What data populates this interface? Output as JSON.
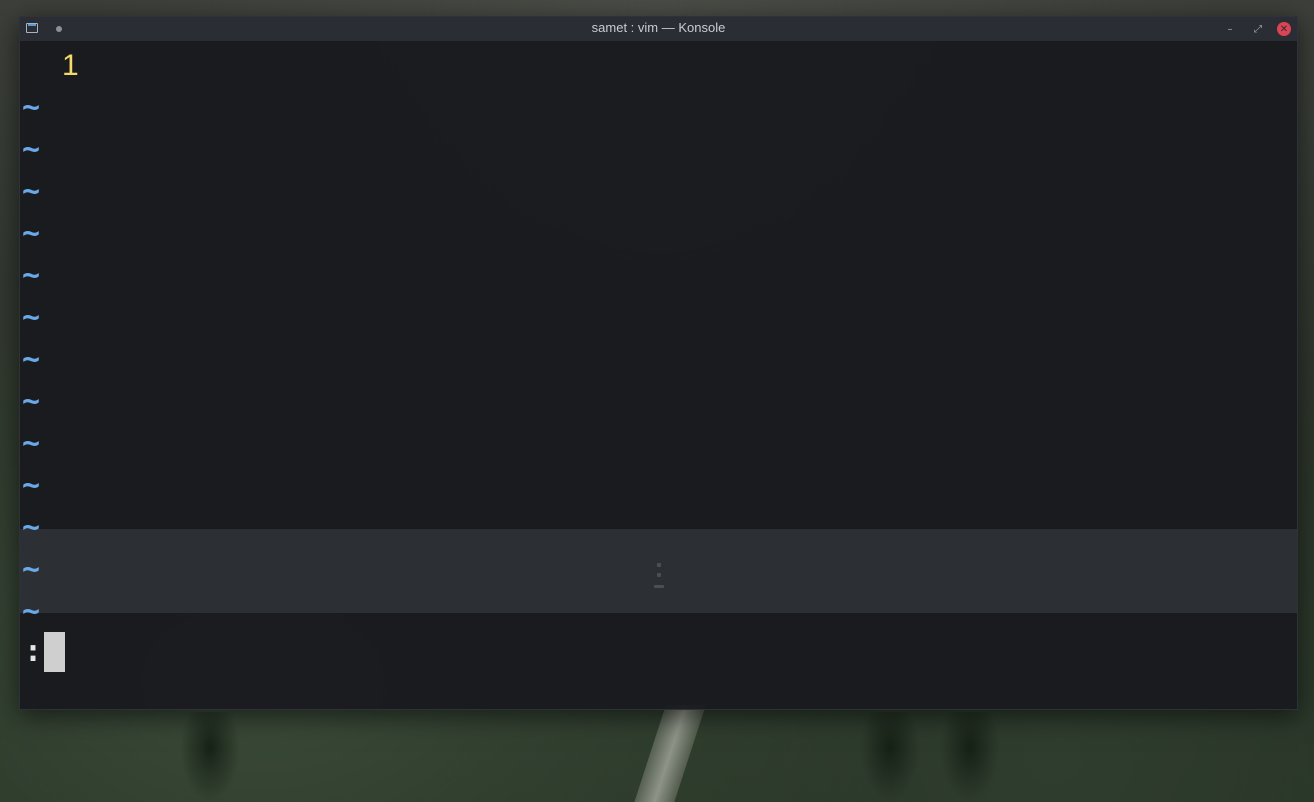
{
  "window": {
    "title": "samet : vim — Konsole",
    "app_icon": "terminal-icon",
    "pin_icon": "dot-icon",
    "minimize_glyph": "–",
    "maximize_glyph": "⤢",
    "close_glyph": "✕"
  },
  "editor": {
    "line_numbers": [
      "1"
    ],
    "empty_line_marker": "~",
    "empty_line_count": 13,
    "command_prefix": ":",
    "mode": "command-line"
  },
  "colors": {
    "line_number": "#f5d96b",
    "tilde": "#6aa9e8",
    "terminal_background": "#191a1e",
    "close_button": "#da4453",
    "cursor": "#cfcfcf"
  }
}
